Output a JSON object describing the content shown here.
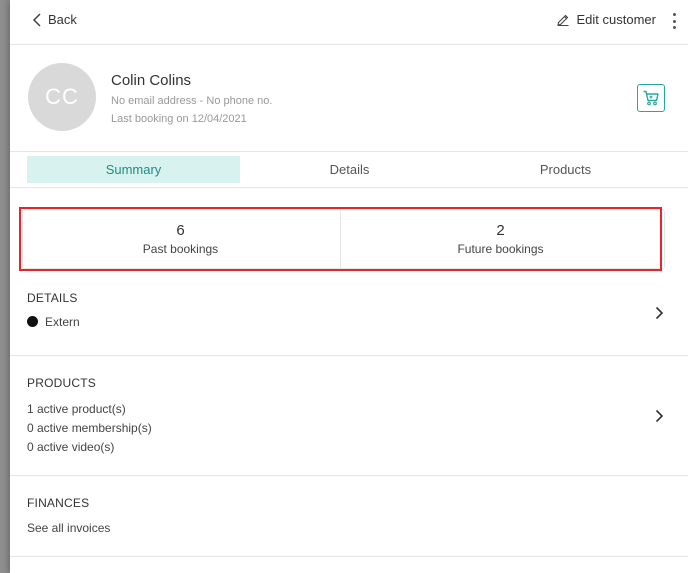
{
  "header": {
    "back_label": "Back",
    "edit_label": "Edit customer"
  },
  "customer": {
    "initials": "CC",
    "name": "Colin Colins",
    "contact": "No email address - No phone no.",
    "last_booking": "Last booking on 12/04/2021"
  },
  "tabs": [
    {
      "label": "Summary",
      "active": true
    },
    {
      "label": "Details",
      "active": false
    },
    {
      "label": "Products",
      "active": false
    }
  ],
  "stats": {
    "past": {
      "value": "6",
      "label": "Past bookings"
    },
    "future": {
      "value": "2",
      "label": "Future bookings"
    }
  },
  "details": {
    "heading": "DETAILS",
    "status": "Extern"
  },
  "products": {
    "heading": "PRODUCTS",
    "lines": [
      "1 active product(s)",
      "0 active membership(s)",
      "0 active video(s)"
    ]
  },
  "finances": {
    "heading": "FINANCES",
    "link": "See all invoices"
  },
  "colors": {
    "accent": "#25a8a0",
    "tab_active_bg": "#d8f2ef",
    "highlight": "#e8232a"
  }
}
